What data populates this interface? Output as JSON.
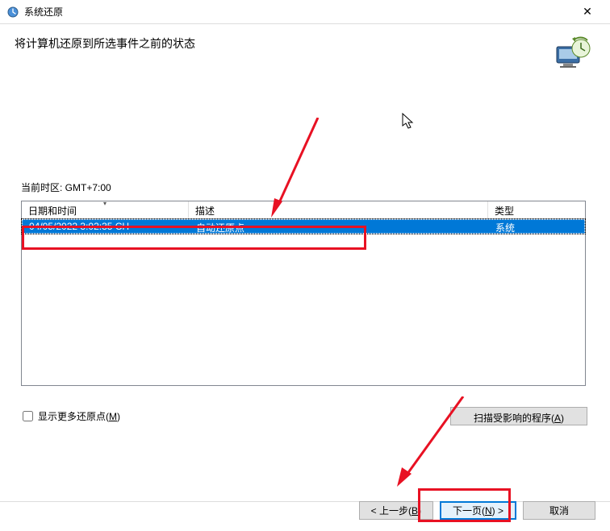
{
  "window": {
    "title": "系统还原",
    "heading": "将计算机还原到所选事件之前的状态"
  },
  "timezone_label": "当前时区: GMT+7:00",
  "table": {
    "columns": {
      "date": "日期和时间",
      "desc": "描述",
      "type": "类型"
    },
    "rows": [
      {
        "date": "04/05/2022 3:02:35 CH",
        "desc": "自动还原点",
        "type": "系统"
      }
    ]
  },
  "options": {
    "show_more_checkbox": "显示更多还原点(",
    "show_more_key": "M",
    "show_more_suffix": ")",
    "scan_button": "扫描受影响的程序(",
    "scan_key": "A",
    "scan_suffix": ")"
  },
  "buttons": {
    "back": "< 上一步(",
    "back_key": "B",
    "back_suffix": ")",
    "next": "下一页(",
    "next_key": "N",
    "next_suffix": ") >",
    "cancel": "取消"
  }
}
